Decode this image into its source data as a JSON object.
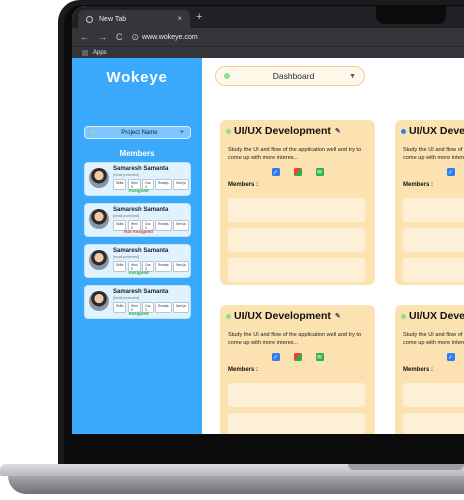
{
  "browser": {
    "tab_title": "New Tab",
    "tab_close": "×",
    "new_tab": "+",
    "url": "www.wokeye.com",
    "bookmarks_apps": "Apps",
    "nav_back": "←",
    "nav_forward": "→",
    "nav_reload": "C"
  },
  "sidebar": {
    "logo": "Wokeye",
    "project_label": "Project Name",
    "project_add": "+",
    "members_title": "Members",
    "members": [
      {
        "name": "Samaresh Samanta",
        "email": "[email protected]",
        "tags": [
          "Skills",
          "Html 5",
          "Css 3",
          "Reactjs",
          "Next.js"
        ],
        "status": "Assigned"
      },
      {
        "name": "Samaresh Samanta",
        "email": "[email protected]",
        "tags": [
          "Skills",
          "Html 5",
          "Css 3",
          "Reactjs",
          "Next.js"
        ],
        "status": "Not Assigned"
      },
      {
        "name": "Samaresh Samanta",
        "email": "[email protected]",
        "tags": [
          "Skills",
          "Html 5",
          "Css 3",
          "Reactjs",
          "Next.js"
        ],
        "status": "Assigned"
      },
      {
        "name": "Samaresh Samanta",
        "email": "[email protected]",
        "tags": [
          "Skills",
          "Html 5",
          "Css 3",
          "Reactjs",
          "Next.js"
        ],
        "status": "Assigned"
      }
    ]
  },
  "dashboard": {
    "label": "Dashboard",
    "caret": "▼"
  },
  "cards": [
    {
      "title": "UI/UX Development",
      "dot_color": "#8ee08f",
      "edit": "✎",
      "desc": "Study the UI and flow of the application well and try to come up with more interes...",
      "members_label": "Members :"
    },
    {
      "title": "UI/UX Development",
      "dot_color": "#2f7df6",
      "edit": "✎",
      "desc": "Study the UI and flow of the application well and try to come up with more interes...",
      "members_label": "Members :"
    },
    {
      "title": "UI/UX Development",
      "dot_color": "#8ee08f",
      "edit": "✎",
      "desc": "Study the UI and flow of the application well and try to come up with more interes...",
      "members_label": "Members :"
    },
    {
      "title": "UI/UX Development",
      "dot_color": "#8ee08f",
      "edit": "✎",
      "desc": "Study the UI and flow of the application well and try to come up with more interes...",
      "members_label": "Members :"
    }
  ],
  "colors": {
    "sidebar": "#3ba9fb",
    "card": "#fde2b1",
    "assigned": "#1bb04a",
    "not_assigned": "#e0453a"
  }
}
